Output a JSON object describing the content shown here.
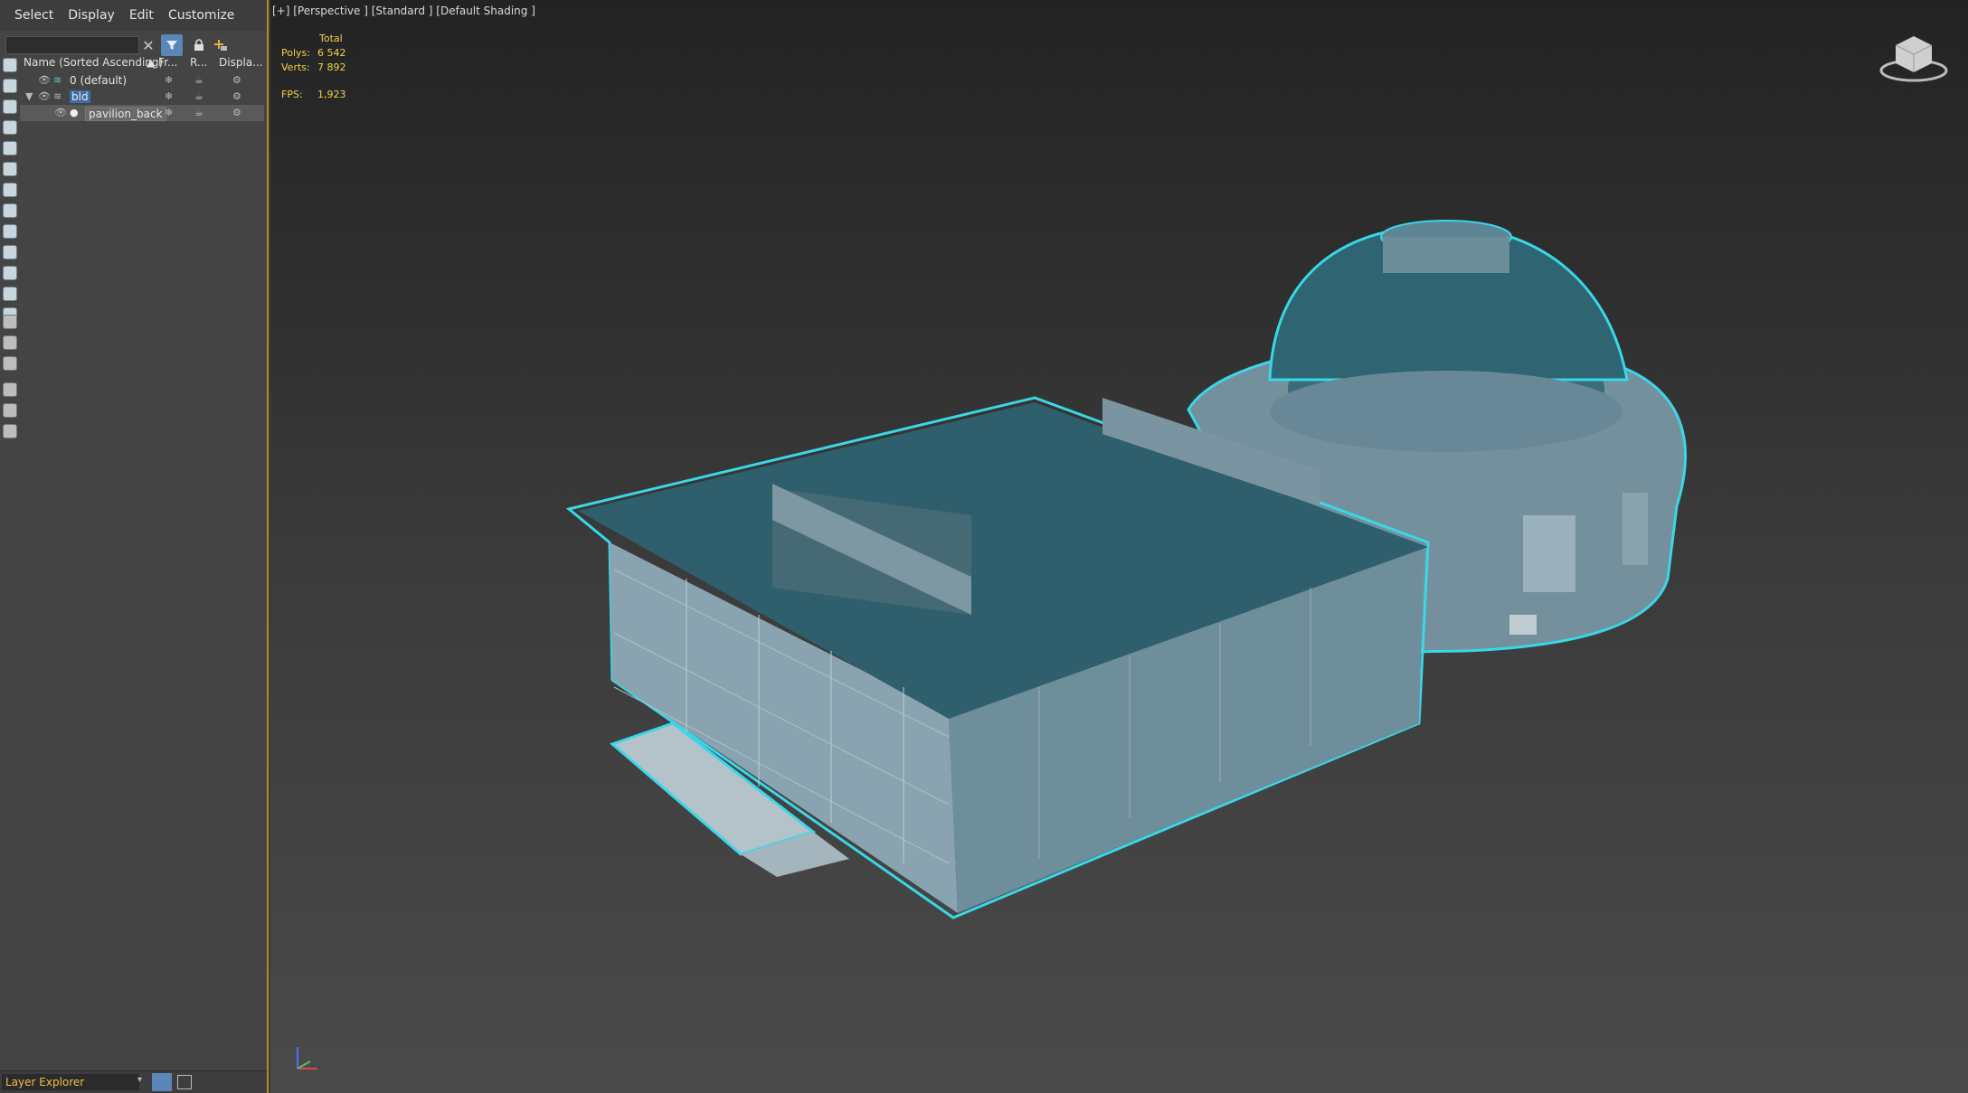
{
  "menu": {
    "items": [
      "Select",
      "Display",
      "Edit",
      "Customize"
    ]
  },
  "explorer": {
    "search_value": "",
    "columns": [
      "Name (Sorted Ascending)",
      "▲ Fr...",
      "R...",
      "Displa..."
    ],
    "layers": [
      {
        "name": "0 (default)",
        "depth": 0,
        "selected": false
      },
      {
        "name": "bld",
        "depth": 0,
        "selected": false
      },
      {
        "name": "pavilion_back",
        "depth": 1,
        "selected": true
      }
    ],
    "footer_label": "Layer Explorer"
  },
  "viewport": {
    "label": "[+] [Perspective ] [Standard ] [Default Shading ]",
    "stats": {
      "total_label": "Total",
      "polys_label": "Polys:",
      "polys_value": "6 542",
      "verts_label": "Verts:",
      "verts_value": "7 892",
      "fps_label": "FPS:",
      "fps_value": "1,923"
    }
  },
  "colors": {
    "selection_outline": "#39d7e8",
    "roof": "#2f5f6c",
    "wall": "#7a98a6",
    "accent": "#b08a2c"
  }
}
